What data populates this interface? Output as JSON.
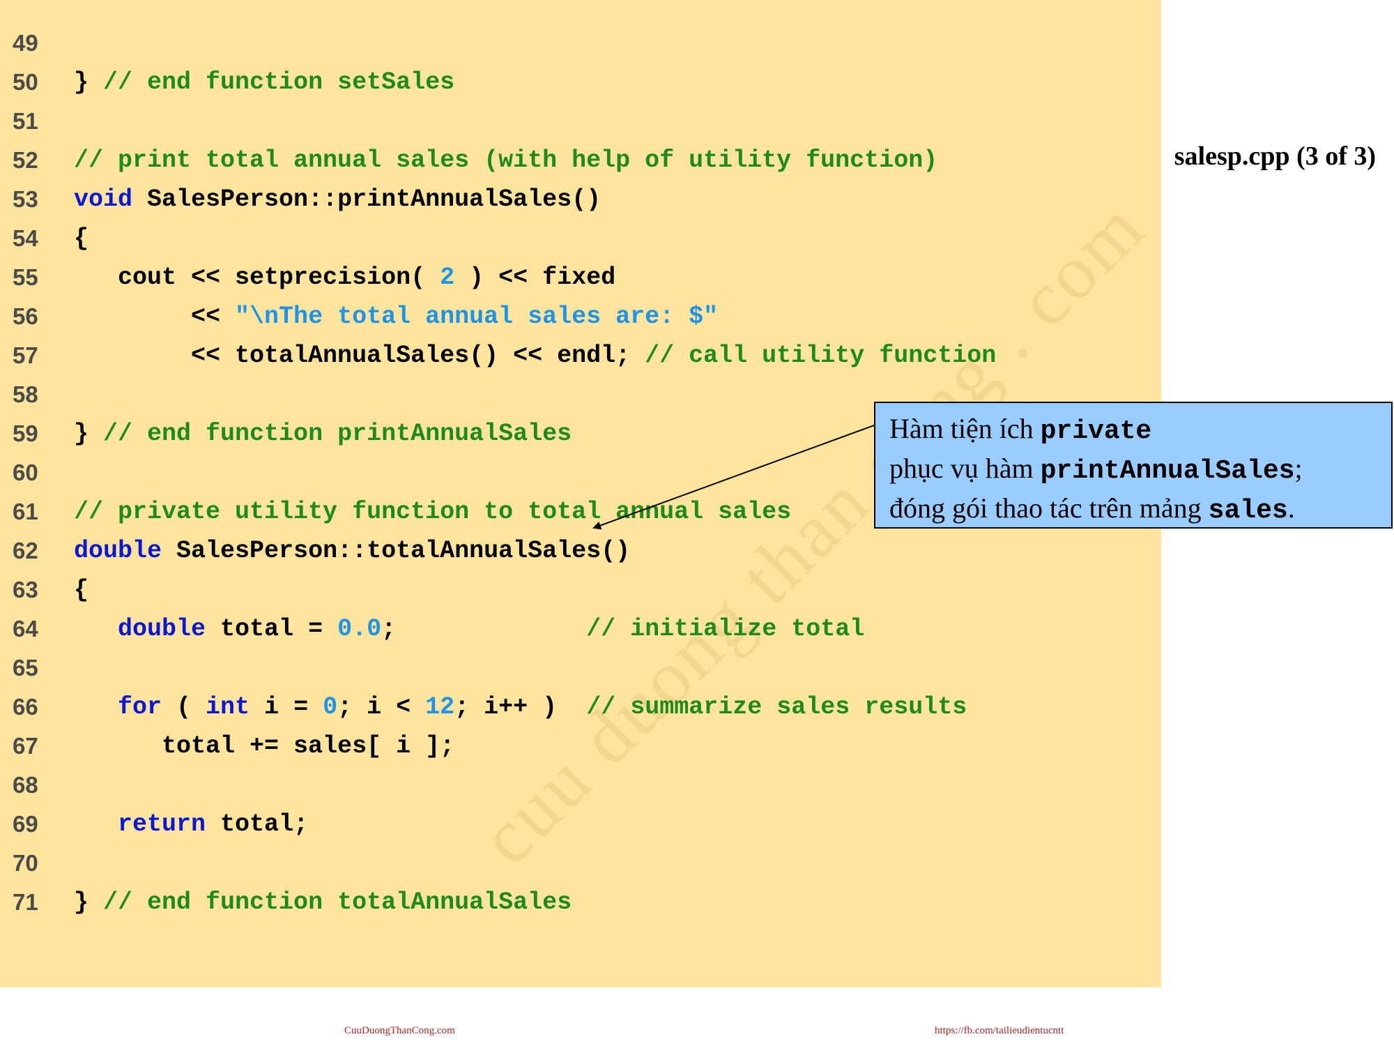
{
  "slide_title": "salesp.cpp (3 of 3)",
  "watermark": "cuu duong than cong . com",
  "callout": {
    "line1_text": "Hàm tiện ích ",
    "line1_code": "private",
    "line2_text": "phục vụ hàm ",
    "line2_code": "printAnnualSales",
    "line2_end": ";",
    "line3_text": "đóng gói thao tác trên mảng ",
    "line3_code": "sales",
    "line3_end": "."
  },
  "footer": {
    "left": "CuuDuongThanCong.com",
    "right": "https://fb.com/tailieudientucntt"
  },
  "code_lines": [
    {
      "num": "49",
      "tokens": []
    },
    {
      "num": "50",
      "tokens": [
        {
          "t": "} ",
          "c": "plain"
        },
        {
          "t": "// end function setSales",
          "c": "comment"
        }
      ]
    },
    {
      "num": "51",
      "tokens": []
    },
    {
      "num": "52",
      "tokens": [
        {
          "t": "// print total annual sales (with help of utility function)",
          "c": "comment"
        }
      ]
    },
    {
      "num": "53",
      "tokens": [
        {
          "t": "void",
          "c": "keyword"
        },
        {
          "t": " SalesPerson::printAnnualSales()",
          "c": "plain"
        }
      ]
    },
    {
      "num": "54",
      "tokens": [
        {
          "t": "{",
          "c": "plain"
        }
      ]
    },
    {
      "num": "55",
      "tokens": [
        {
          "t": "   cout << setprecision( ",
          "c": "plain"
        },
        {
          "t": "2",
          "c": "number"
        },
        {
          "t": " ) << fixed",
          "c": "plain"
        }
      ]
    },
    {
      "num": "56",
      "tokens": [
        {
          "t": "        << ",
          "c": "plain"
        },
        {
          "t": "\"\\nThe total annual sales are: $\"",
          "c": "string"
        }
      ]
    },
    {
      "num": "57",
      "tokens": [
        {
          "t": "        << totalAnnualSales() << endl; ",
          "c": "plain"
        },
        {
          "t": "// call utility function",
          "c": "comment"
        }
      ]
    },
    {
      "num": "58",
      "tokens": []
    },
    {
      "num": "59",
      "tokens": [
        {
          "t": "} ",
          "c": "plain"
        },
        {
          "t": "// end function printAnnualSales",
          "c": "comment"
        }
      ]
    },
    {
      "num": "60",
      "tokens": []
    },
    {
      "num": "61",
      "tokens": [
        {
          "t": "// private utility function to total annual sales",
          "c": "comment"
        }
      ]
    },
    {
      "num": "62",
      "tokens": [
        {
          "t": "double",
          "c": "keyword"
        },
        {
          "t": " SalesPerson::totalAnnualSales()",
          "c": "plain"
        }
      ]
    },
    {
      "num": "63",
      "tokens": [
        {
          "t": "{",
          "c": "plain"
        }
      ]
    },
    {
      "num": "64",
      "tokens": [
        {
          "t": "   ",
          "c": "plain"
        },
        {
          "t": "double",
          "c": "keyword"
        },
        {
          "t": " total = ",
          "c": "plain"
        },
        {
          "t": "0.0",
          "c": "number"
        },
        {
          "t": ";             ",
          "c": "plain"
        },
        {
          "t": "// initialize total",
          "c": "comment"
        }
      ]
    },
    {
      "num": "65",
      "tokens": []
    },
    {
      "num": "66",
      "tokens": [
        {
          "t": "   ",
          "c": "plain"
        },
        {
          "t": "for",
          "c": "keyword"
        },
        {
          "t": " ( ",
          "c": "plain"
        },
        {
          "t": "int",
          "c": "keyword"
        },
        {
          "t": " i = ",
          "c": "plain"
        },
        {
          "t": "0",
          "c": "number"
        },
        {
          "t": "; i < ",
          "c": "plain"
        },
        {
          "t": "12",
          "c": "number"
        },
        {
          "t": "; i++ )  ",
          "c": "plain"
        },
        {
          "t": "// summarize sales results",
          "c": "comment"
        }
      ]
    },
    {
      "num": "67",
      "tokens": [
        {
          "t": "      total += sales[ i ];",
          "c": "plain"
        }
      ]
    },
    {
      "num": "68",
      "tokens": []
    },
    {
      "num": "69",
      "tokens": [
        {
          "t": "   ",
          "c": "plain"
        },
        {
          "t": "return",
          "c": "keyword"
        },
        {
          "t": " total;",
          "c": "plain"
        }
      ]
    },
    {
      "num": "70",
      "tokens": []
    },
    {
      "num": "71",
      "tokens": [
        {
          "t": "} ",
          "c": "plain"
        },
        {
          "t": "// end function totalAnnualSales",
          "c": "comment"
        }
      ]
    }
  ]
}
